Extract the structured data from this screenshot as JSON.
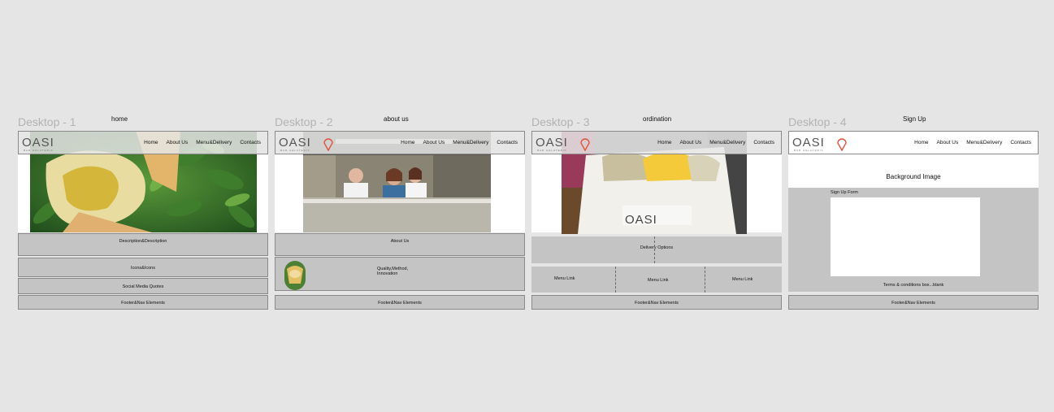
{
  "frames": [
    {
      "label": "Desktop - 1",
      "title": "home",
      "sections": {
        "description": "Description&Description",
        "icons": "Icons&Icons",
        "social": "Social Media Quotes",
        "footer": "Footer&Nav Elements"
      }
    },
    {
      "label": "Desktop - 2",
      "title": "about us",
      "sections": {
        "about": "About Us",
        "quality_line1": "Quality,Method,",
        "quality_line2": "Innovation",
        "footer": "Footer&Nav Elements"
      }
    },
    {
      "label": "Desktop - 3",
      "title": "ordination",
      "sections": {
        "delivery": "Delivery Options",
        "menu_link_1": "Menu Link",
        "menu_link_2": "Menu Link",
        "menu_link_3": "Menu Link",
        "footer": "Footer&Nav Elements"
      }
    },
    {
      "label": "Desktop - 4",
      "title": "Sign Up",
      "sections": {
        "background": "Background Image",
        "signup_form": "Sign Up Form",
        "terms": "Terms & conditions box...blank",
        "footer": "Footer&Nav Elements"
      }
    }
  ],
  "nav": {
    "logo": "OASI",
    "logo_sub": "BAR GELATERIA",
    "items": [
      "Home",
      "About Us",
      "Menu&Delivery",
      "Contacts"
    ]
  },
  "colors": {
    "canvas": "#e5e5e5",
    "section_gray": "#c4c4c4",
    "logo_accent": "#e0523c"
  }
}
